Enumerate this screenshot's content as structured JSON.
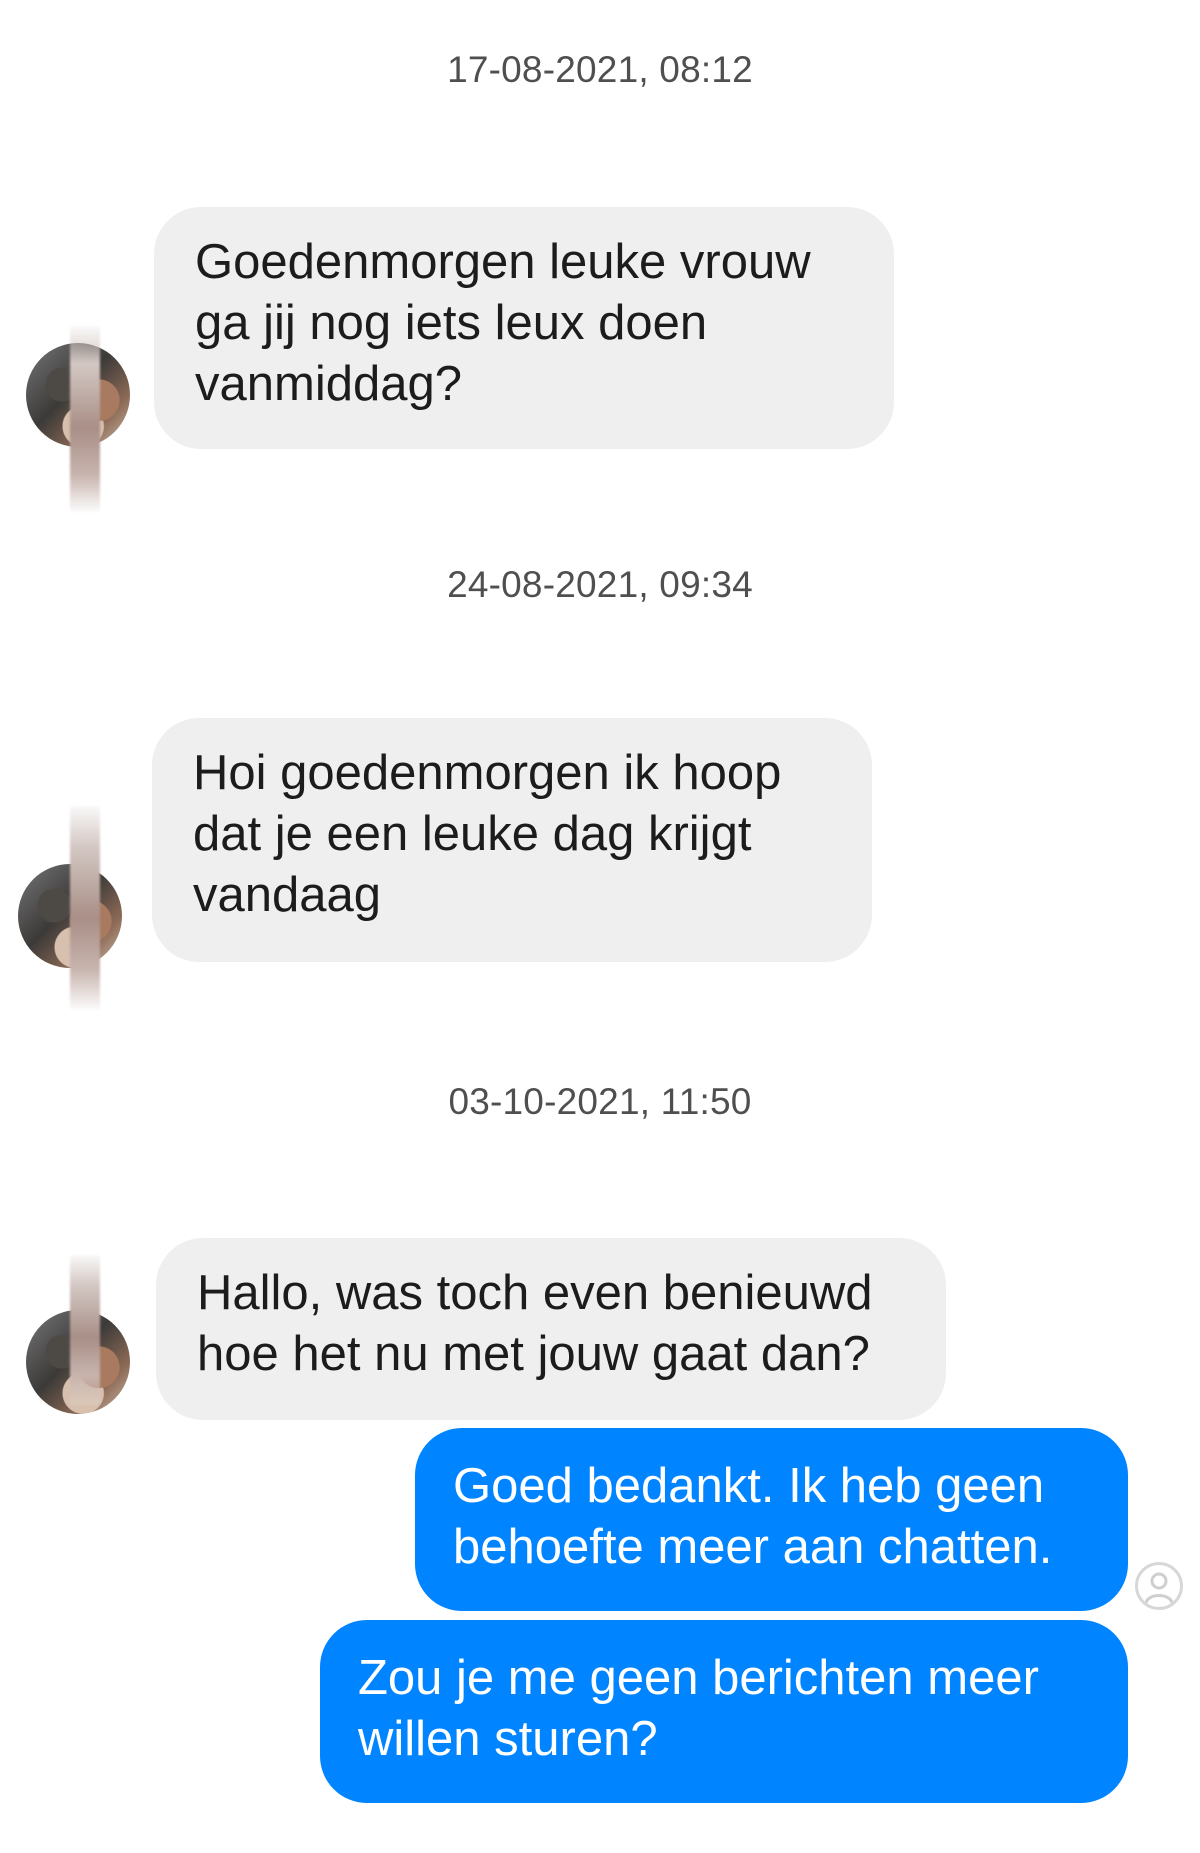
{
  "conversation": [
    {
      "timestamp": "17-08-2021, 08:12",
      "message": {
        "direction": "incoming",
        "lines": [
          "Goedenmorgen leuke vrouw",
          "ga jij nog iets leux doen",
          "vanmiddag?"
        ]
      }
    },
    {
      "timestamp": "24-08-2021, 09:34",
      "message": {
        "direction": "incoming",
        "lines": [
          "Hoi goedenmorgen ik hoop",
          "dat je een leuke dag krijgt",
          "vandaag"
        ]
      }
    },
    {
      "timestamp": "03-10-2021, 11:50",
      "message": {
        "direction": "incoming",
        "lines": [
          "Hallo, was toch even benieuwd",
          "hoe het nu met jouw gaat dan?"
        ]
      }
    }
  ],
  "outgoing": [
    {
      "direction": "outgoing",
      "lines": [
        "Goed bedankt. Ik heb geen",
        "behoefte meer aan chatten."
      ]
    },
    {
      "direction": "outgoing",
      "lines": [
        "Zou je me geen berichten meer",
        "willen sturen?"
      ]
    }
  ],
  "icons": {
    "contact_avatar": "avatar-icon",
    "read_receipt": "seen-avatar-icon",
    "privacy_blur": "blur-overlay"
  },
  "colors": {
    "incoming_bubble": "#efefef",
    "outgoing_bubble": "#0084ff",
    "timestamp_text": "#4f4f4f",
    "incoming_text": "#1c1c1c",
    "outgoing_text": "#ffffff"
  }
}
